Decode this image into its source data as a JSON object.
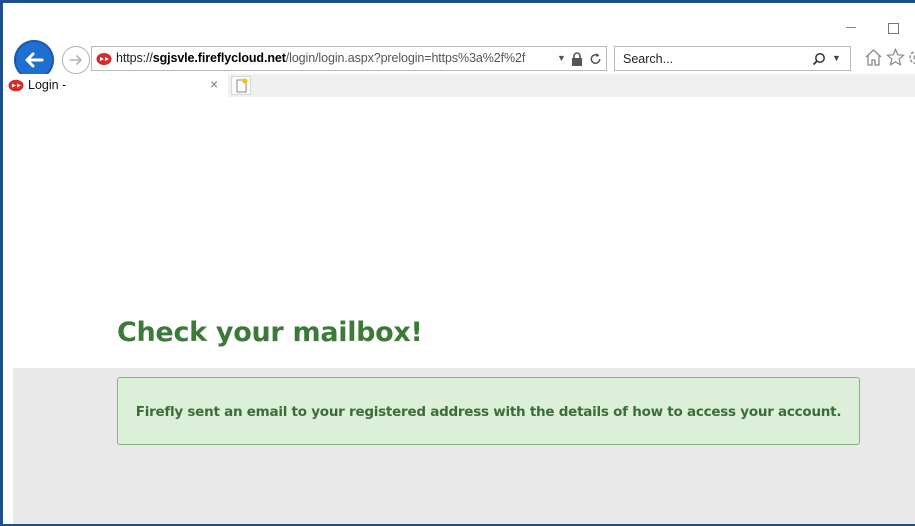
{
  "browser": {
    "address": {
      "scheme": "https://",
      "domain": "sgjsvle.fireflycloud.net",
      "path": "/login/login.aspx?prelogin=https%3a%2f%2f"
    },
    "search": {
      "placeholder": "Search..."
    },
    "tab": {
      "label": "Login -",
      "close": "×"
    }
  },
  "page": {
    "title": "Check your mailbox!",
    "message": "Firefly sent an email to your registered address with the details of how to access your account."
  },
  "colors": {
    "accent_blue": "#1e6fd0",
    "title_green": "#3d7a3a",
    "alert_bg": "#dcefd8",
    "alert_border": "#7fb877",
    "firefly_red": "#d42b2b"
  },
  "icons": [
    "back-icon",
    "forward-icon",
    "firefly-icon",
    "lock-icon",
    "refresh-icon",
    "search-icon",
    "home-icon",
    "favorites-icon",
    "gear-icon",
    "new-tab-icon"
  ]
}
